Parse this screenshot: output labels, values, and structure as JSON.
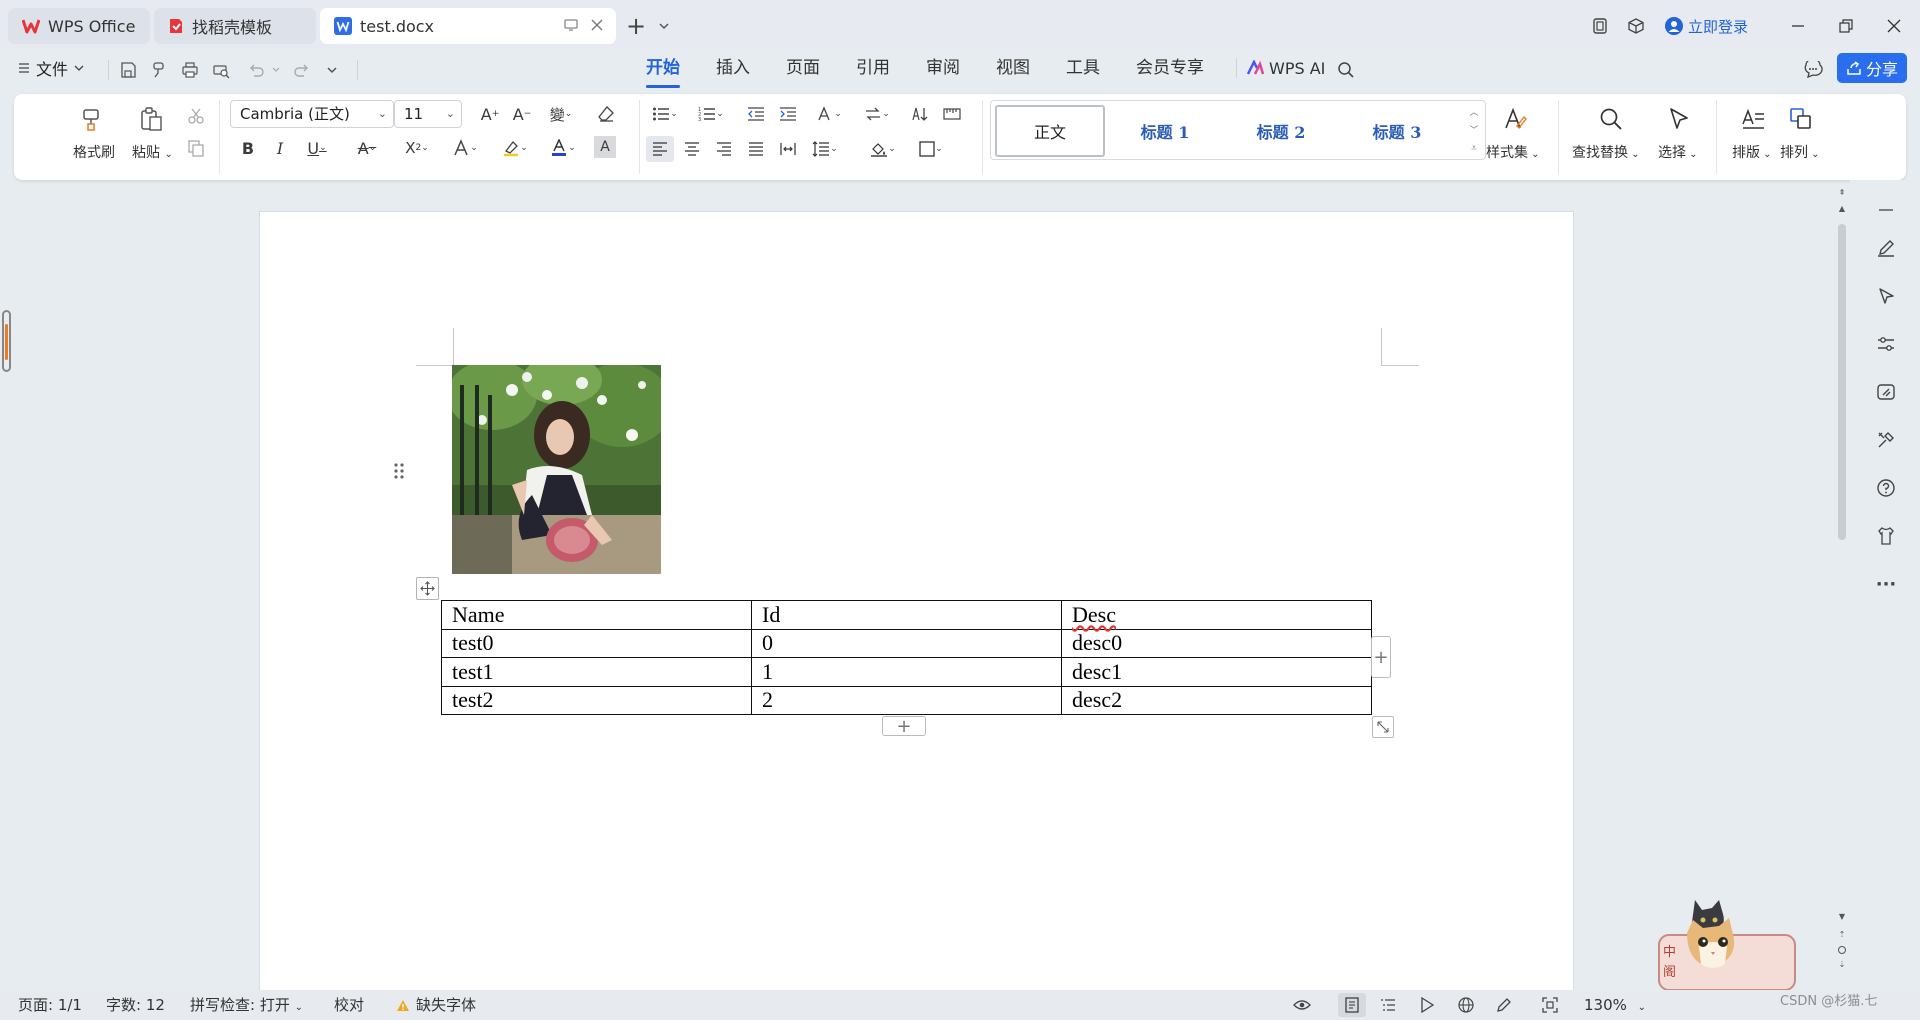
{
  "tabs": {
    "wps_office": "WPS Office",
    "template": "找稻壳模板",
    "document": "test.docx"
  },
  "window": {
    "login": "立即登录",
    "new_tab": "+"
  },
  "menu": {
    "file": "文件",
    "tabs": [
      "开始",
      "插入",
      "页面",
      "引用",
      "审阅",
      "视图",
      "工具",
      "会员专享"
    ],
    "active_tab": "开始",
    "wps_ai": "WPS AI",
    "share": "分享"
  },
  "ribbon": {
    "format_painter": "格式刷",
    "paste": "粘贴",
    "font_name": "Cambria (正文)",
    "font_size": "11",
    "styles": {
      "normal": "正文",
      "heading1": "标题 1",
      "heading2": "标题 2",
      "heading3": "标题 3"
    },
    "style_set": "样式集",
    "find_replace": "查找替换",
    "select": "选择",
    "typesetting": "排版",
    "arrange": "排列"
  },
  "document": {
    "image_alt": "photo of a girl crouching by a fence with flowers",
    "table": {
      "headers": [
        "Name",
        "Id",
        "Desc"
      ],
      "rows": [
        [
          "test0",
          "0",
          "desc0"
        ],
        [
          "test1",
          "1",
          "desc1"
        ],
        [
          "test2",
          "2",
          "desc2"
        ]
      ]
    },
    "add_row": "+",
    "add_col": "+"
  },
  "status": {
    "page": "页面: 1/1",
    "word_count": "字数: 12",
    "spell_check": "拼写检查: 打开",
    "proofread": "校对",
    "missing_font": "缺失字体",
    "zoom": "130%"
  },
  "watermark": "CSDN @杉猫.七",
  "colors": {
    "accent": "#2463d8",
    "wps_red": "#e8343b",
    "doc_blue": "#2f6ce5",
    "heading_blue": "#2b5cb8",
    "share_bg": "#2a6ef0",
    "font_color_bar": "#2a3fd6"
  }
}
